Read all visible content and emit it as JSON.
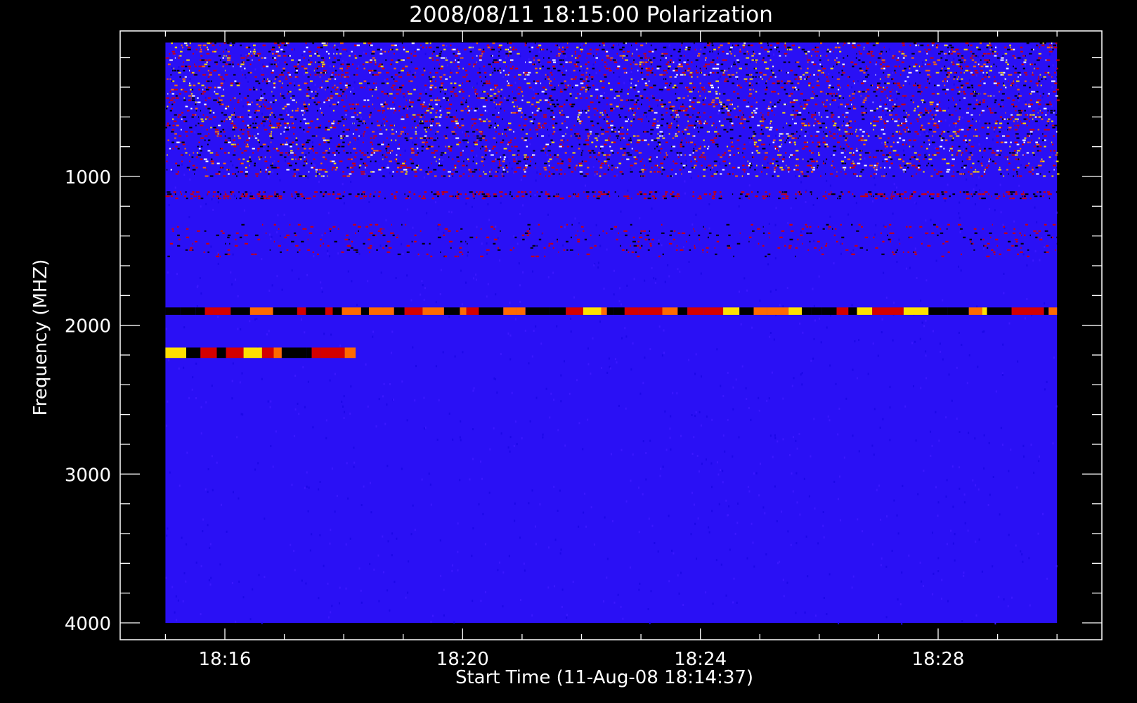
{
  "chart_data": {
    "type": "heatmap",
    "title": "2008/08/11 18:15:00 Polarization",
    "xlabel": "Start Time (11-Aug-08 18:14:37)",
    "ylabel": "Frequency (MHZ)",
    "x_ticks": [
      "18:16",
      "18:20",
      "18:24",
      "18:28"
    ],
    "y_ticks": [
      1000,
      2000,
      3000,
      4000
    ],
    "x_range": [
      "18:14:37",
      "18:30:11"
    ],
    "xlim_minutes": [
      14.62,
      30.18
    ],
    "ylim": [
      4150,
      100
    ],
    "data_x_range_minutes": [
      15.0,
      30.0
    ],
    "data_y_range": [
      100,
      4000
    ],
    "y_inverted": true,
    "colormap": [
      "#000000",
      "#1a00ff",
      "#2200ff",
      "#d40000",
      "#ff6a00",
      "#ffe000",
      "#ffffff"
    ],
    "background_color": "#2a10f5",
    "features": [
      {
        "label": "RFI noise band",
        "y": [
          100,
          1000
        ],
        "level": "high"
      },
      {
        "label": "faint band",
        "y": [
          1100,
          1150
        ],
        "level": "low"
      },
      {
        "label": "faint band",
        "y": [
          1320,
          1550
        ],
        "level": "low"
      },
      {
        "label": "emission line",
        "y": [
          1880,
          1930
        ],
        "x_minutes": [
          15.0,
          30.0
        ],
        "level": "strong"
      },
      {
        "label": "emission line",
        "y": [
          2150,
          2220
        ],
        "x_minutes": [
          15.0,
          18.2
        ],
        "level": "strong"
      }
    ]
  }
}
